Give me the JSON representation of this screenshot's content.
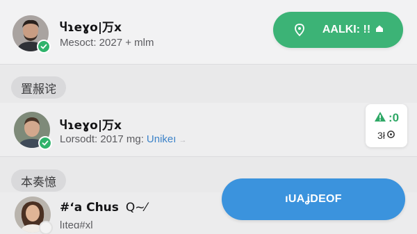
{
  "contacts": [
    {
      "name": "Ⴗɿeɣo|万x",
      "subtitle": "Mesoct: 2027 + mlm",
      "status": "online"
    },
    {
      "name": "Ⴗɿeɣo|万x",
      "subtitle": "Lorsodt: 2017 mg:",
      "link": "Unikeı",
      "faint": "→",
      "status": "online"
    },
    {
      "name": "#ʻa Chus",
      "name_suffix": "Q~⁄",
      "subtitle": "lıteɑ#xl",
      "status": "pending"
    }
  ],
  "sections": {
    "first": "置赧诧",
    "second": "本奏憶"
  },
  "actions": {
    "green_button": "AALKI: !!",
    "mini_card_top": ":0",
    "mini_card_bottom": "3ł",
    "blue_button": "ıUAʝDEOF"
  },
  "colors": {
    "green": "#3cb376",
    "blue": "#3b93dd",
    "status_green": "#2fb36b",
    "link_blue": "#3b82c8"
  },
  "icons": {
    "green_button_left": "location-pin-icon",
    "green_button_right": "home-icon",
    "mini_card_top": "alert-triangle-icon",
    "mini_card_bottom": "refresh-icon"
  }
}
